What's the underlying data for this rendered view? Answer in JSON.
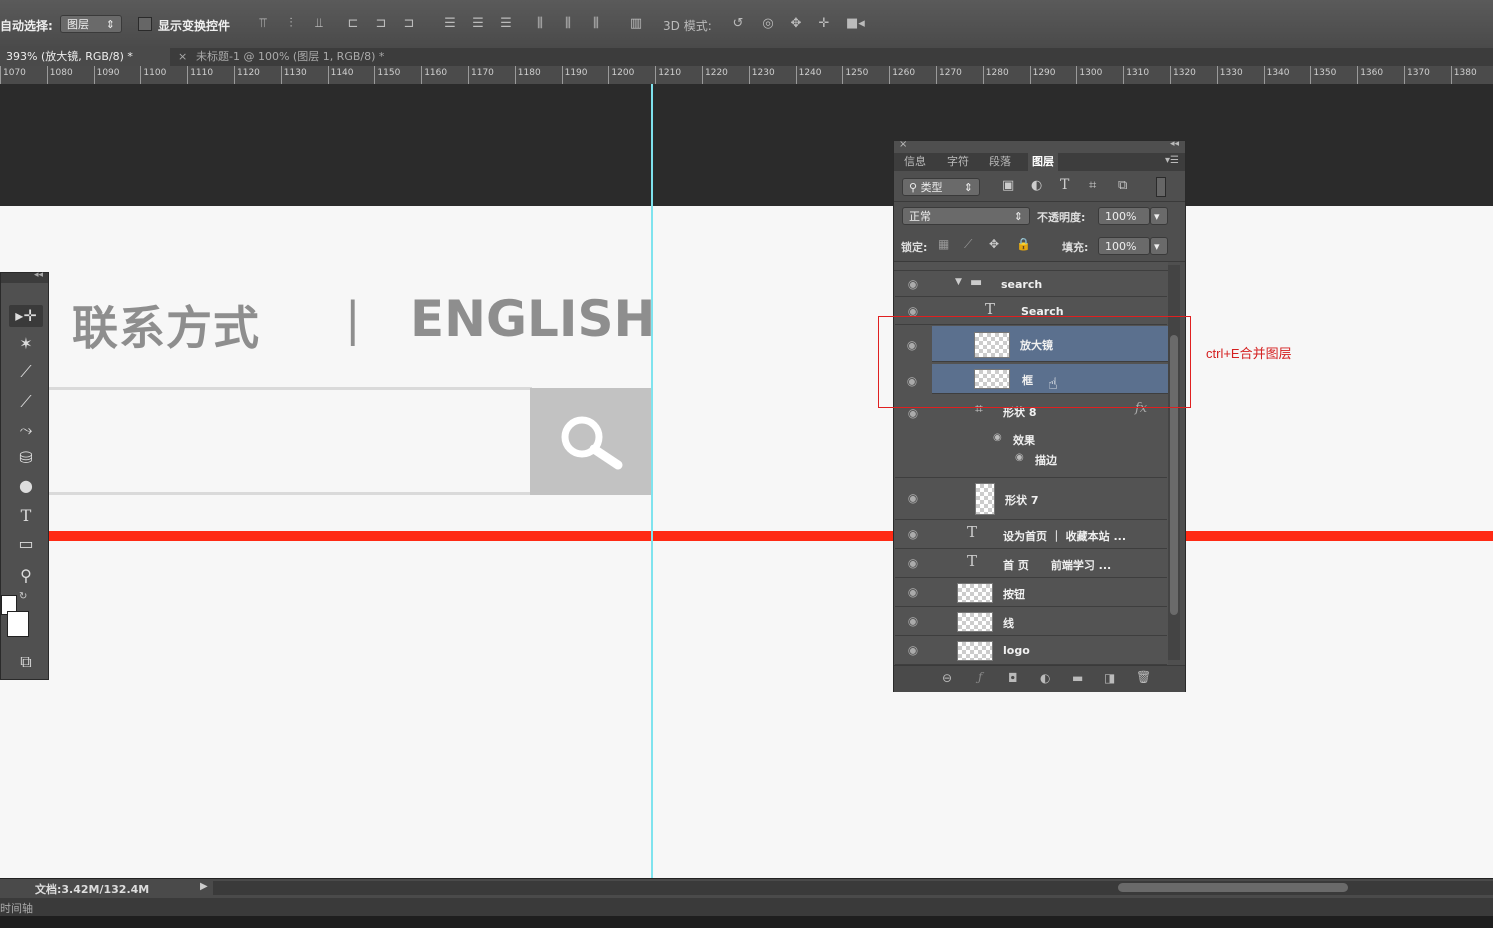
{
  "options_bar": {
    "auto_select_label": "自动选择:",
    "auto_select_value": "图层",
    "show_transform_label": "显示变换控件",
    "mode_3d_label": "3D 模式:"
  },
  "tabs": [
    {
      "label": "393% (放大镜, RGB/8) *"
    },
    {
      "label": "未标题-1 @ 100% (图层 1, RGB/8) *"
    }
  ],
  "ruler_ticks": [
    "1070",
    "1080",
    "1090",
    "1100",
    "1110",
    "1120",
    "1130",
    "1140",
    "1150",
    "1160",
    "1170",
    "1180",
    "1190",
    "1200",
    "1210",
    "1220",
    "1230",
    "1240",
    "1250",
    "1260",
    "1270",
    "1280",
    "1290",
    "1300",
    "1310",
    "1320",
    "1330",
    "1340",
    "1350",
    "1360",
    "1370",
    "1380"
  ],
  "canvas": {
    "contact_text": "联系方式",
    "separator": "|",
    "english_text": "ENGLISH"
  },
  "colors": {
    "red_line": "#ff2a14",
    "guide": "#7fe3ee",
    "selection": "#5b708e",
    "annotation": "#d42020"
  },
  "layers_panel": {
    "tabs": [
      "信息",
      "字符",
      "段落",
      "图层"
    ],
    "active_tab": "图层",
    "filter_label": "类型",
    "blend_mode": "正常",
    "opacity_label": "不透明度:",
    "opacity_value": "100%",
    "lock_label": "锁定:",
    "fill_label": "填充:",
    "fill_value": "100%",
    "layers": [
      {
        "name": "search",
        "kind": "group"
      },
      {
        "name": "Search",
        "kind": "text"
      },
      {
        "name": "放大镜",
        "kind": "shape",
        "selected": true
      },
      {
        "name": "框",
        "kind": "pixel",
        "selected": true
      },
      {
        "name": "形状 8",
        "kind": "shape",
        "fx": "fx"
      },
      {
        "name": "效果",
        "kind": "effect"
      },
      {
        "name": "描边",
        "kind": "effect"
      },
      {
        "name": "形状 7",
        "kind": "shape"
      },
      {
        "name": "设为首页 ｜ 收藏本站 ...",
        "kind": "text"
      },
      {
        "name": "首 页　　前端学习 ...",
        "kind": "text"
      },
      {
        "name": "按钮",
        "kind": "pixel"
      },
      {
        "name": "线",
        "kind": "pixel"
      },
      {
        "name": "logo",
        "kind": "pixel"
      }
    ]
  },
  "annotation": {
    "note": "ctrl+E合并图层"
  },
  "status_bar": {
    "doc_size": "文档:3.42M/132.4M",
    "timeline": "时间轴"
  }
}
